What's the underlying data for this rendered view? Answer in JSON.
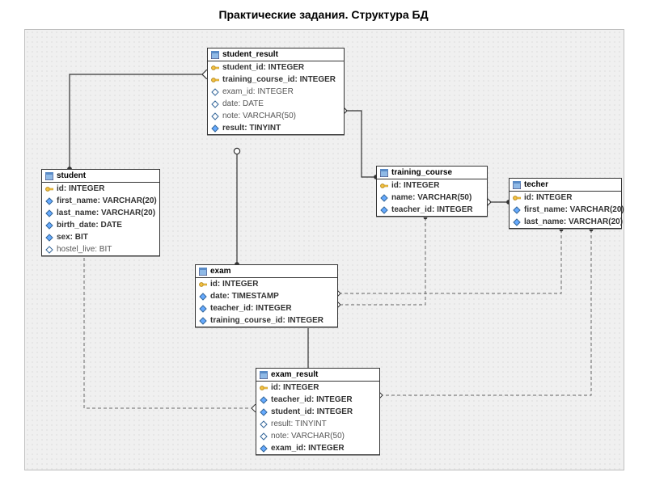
{
  "title": "Практические задания. Структура БД",
  "entities": {
    "student": {
      "name": "student",
      "fields": [
        "id: INTEGER",
        "first_name: VARCHAR(20)",
        "last_name: VARCHAR(20)",
        "birth_date: DATE",
        "sex: BIT",
        "hostel_live: BIT"
      ]
    },
    "student_result": {
      "name": "student_result",
      "fields": [
        "student_id: INTEGER",
        "training_course_id: INTEGER",
        "exam_id: INTEGER",
        "date: DATE",
        "note: VARCHAR(50)",
        "result: TINYINT"
      ]
    },
    "training_course": {
      "name": "training_course",
      "fields": [
        "id: INTEGER",
        "name: VARCHAR(50)",
        "teacher_id: INTEGER"
      ]
    },
    "techer": {
      "name": "techer",
      "fields": [
        "id: INTEGER",
        "first_name: VARCHAR(20)",
        "last_name: VARCHAR(20)"
      ]
    },
    "exam": {
      "name": "exam",
      "fields": [
        "id: INTEGER",
        "date: TIMESTAMP",
        "teacher_id: INTEGER",
        "training_course_id: INTEGER"
      ]
    },
    "exam_result": {
      "name": "exam_result",
      "fields": [
        "id: INTEGER",
        "teacher_id: INTEGER",
        "student_id: INTEGER",
        "result: TINYINT",
        "note: VARCHAR(50)",
        "exam_id: INTEGER"
      ]
    }
  },
  "relationships": [
    {
      "from": "student",
      "to": "student_result",
      "style": "solid"
    },
    {
      "from": "training_course",
      "to": "student_result",
      "style": "solid"
    },
    {
      "from": "exam",
      "to": "student_result",
      "style": "solid"
    },
    {
      "from": "techer",
      "to": "training_course",
      "style": "solid"
    },
    {
      "from": "techer",
      "to": "exam",
      "style": "dashed"
    },
    {
      "from": "techer",
      "to": "exam_result",
      "style": "dashed"
    },
    {
      "from": "student",
      "to": "exam_result",
      "style": "dashed"
    },
    {
      "from": "training_course",
      "to": "exam",
      "style": "dashed"
    },
    {
      "from": "exam",
      "to": "exam_result",
      "style": "solid"
    }
  ]
}
